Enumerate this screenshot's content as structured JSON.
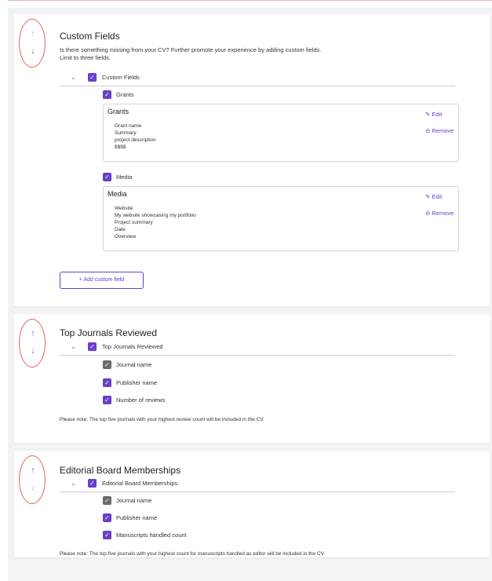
{
  "icons": {
    "move_up": "↑",
    "move_down": "↓",
    "expand": "⌄",
    "check": "✓",
    "edit": "✎",
    "remove": "⊖",
    "add": "+"
  },
  "accent_color": "#6a3fc8",
  "highlight_circle_color": "#e0654f",
  "custom_fields": {
    "title": "Custom Fields",
    "description_line1": "Is there something missing from your CV? Further promote your experience by adding custom fields.",
    "description_line2": "Limit to three fields.",
    "group_label": "Custom Fields",
    "grants": {
      "checkbox_label": "Grants",
      "card_title": "Grants",
      "lines": [
        "Grant name",
        "Summary",
        "project description",
        "$$$$"
      ],
      "edit_label": "Edit",
      "remove_label": "Remove"
    },
    "media": {
      "checkbox_label": "Media",
      "card_title": "Media",
      "lines": [
        "Website",
        "My website showcasing my portfolio",
        "Project summary",
        "Date",
        "Overview"
      ],
      "edit_label": "Edit",
      "remove_label": "Remove"
    },
    "add_button_label": "Add custom field"
  },
  "top_journals": {
    "title": "Top Journals Reviewed",
    "group_label": "Top Journals Reviewed",
    "items": [
      {
        "label": "Journal name",
        "checked": true,
        "locked": true
      },
      {
        "label": "Publisher name",
        "checked": true,
        "locked": false
      },
      {
        "label": "Number of reviews",
        "checked": true,
        "locked": false
      }
    ],
    "note": "Please note: The top five journals with your highest review count will be included in the CV."
  },
  "editorial_board": {
    "title": "Editorial Board Memberships",
    "group_label": "Editorial Board Memberships",
    "items": [
      {
        "label": "Journal name",
        "checked": true,
        "locked": true
      },
      {
        "label": "Publisher name",
        "checked": true,
        "locked": false
      },
      {
        "label": "Manuscripts handled count",
        "checked": true,
        "locked": false
      }
    ],
    "note": "Please note: The top five journals with your highest count for manuscripts handled as editor will be included in the CV."
  }
}
